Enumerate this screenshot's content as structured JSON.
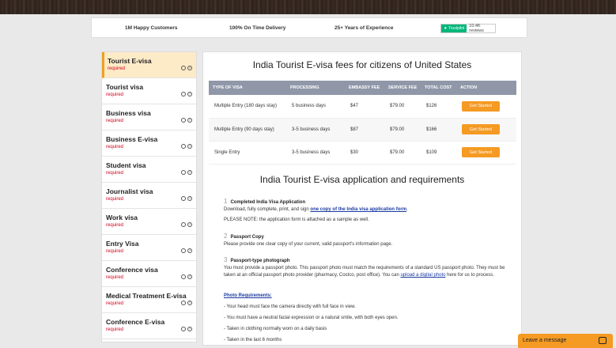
{
  "trust_bar": {
    "items": [
      "1M Happy Customers",
      "100% On Time Delivery",
      "25+ Years of Experience"
    ],
    "trustpilot_label": "Trustpilot",
    "reviews": "10.4K reviews"
  },
  "sidebar": {
    "items": [
      {
        "title": "Tourist E-visa",
        "status": "required",
        "active": true
      },
      {
        "title": "Tourist visa",
        "status": "required"
      },
      {
        "title": "Business visa",
        "status": "required"
      },
      {
        "title": "Business E-visa",
        "status": "required"
      },
      {
        "title": "Student visa",
        "status": "required"
      },
      {
        "title": "Journalist visa",
        "status": "required"
      },
      {
        "title": "Work visa",
        "status": "required"
      },
      {
        "title": "Entry Visa",
        "status": "required"
      },
      {
        "title": "Conference visa",
        "status": "required"
      },
      {
        "title": "Medical Treatment E-visa",
        "status": "required"
      },
      {
        "title": "Conference E-visa",
        "status": "required"
      }
    ]
  },
  "main": {
    "fees_title": "India Tourist E-visa fees for citizens of United States",
    "table": {
      "headers": [
        "TYPE OF VISA",
        "PROCESSING",
        "EMBASSY FEE",
        "SERVICE FEE",
        "TOTAL COST",
        "ACTION"
      ],
      "rows": [
        {
          "type": "Multiple Entry (180 days stay)",
          "processing": "5 business days",
          "embassy": "$47",
          "service": "$79.00",
          "total": "$126",
          "action": "Get Started"
        },
        {
          "type": "Multiple Entry (90 days stay)",
          "processing": "3-5 business days",
          "embassy": "$87",
          "service": "$79.00",
          "total": "$166",
          "action": "Get Started"
        },
        {
          "type": "Single Entry",
          "processing": "3-5 business days",
          "embassy": "$30",
          "service": "$79.00",
          "total": "$109",
          "action": "Get Started"
        }
      ]
    },
    "requirements_title": "India Tourist E-visa application and requirements",
    "req1": {
      "num": "1",
      "title": "Completed India Visa Application",
      "text_a": "Download, fully complete, print, and sign ",
      "link": "one copy of the India visa application form",
      "text_b": ".",
      "note": "PLEASE NOTE: the application form is attached as a sample as well."
    },
    "req2": {
      "num": "2",
      "title": "Passport Copy",
      "text": "Please provide one clear copy of your current, valid passport's information page."
    },
    "req3": {
      "num": "3",
      "title": "Passport-type photograph",
      "text_a": "You must provide a passport photo. This passport photo must match the requirements of a standard US passport photo. They must be taken at an official passport photo provider (pharmacy, Costco, post office).  You can ",
      "link": "upload a digital photo",
      "text_b": " here for us to process."
    },
    "photo_req_title": "Photo Requirements:",
    "photo_reqs": [
      "- Your head must face the camera directly with full face in view.",
      "- You must have a neutral facial expression or a natural smile, with both eyes open.",
      "- Taken in clothing normally worn on a daily basis",
      "- Taken in the last 6 months"
    ]
  },
  "chat": {
    "label": "Leave a message"
  },
  "colors": {
    "accent": "#f59a23",
    "header": "#8f97a8",
    "required": "#d0021b",
    "link": "#1a3aa0"
  }
}
